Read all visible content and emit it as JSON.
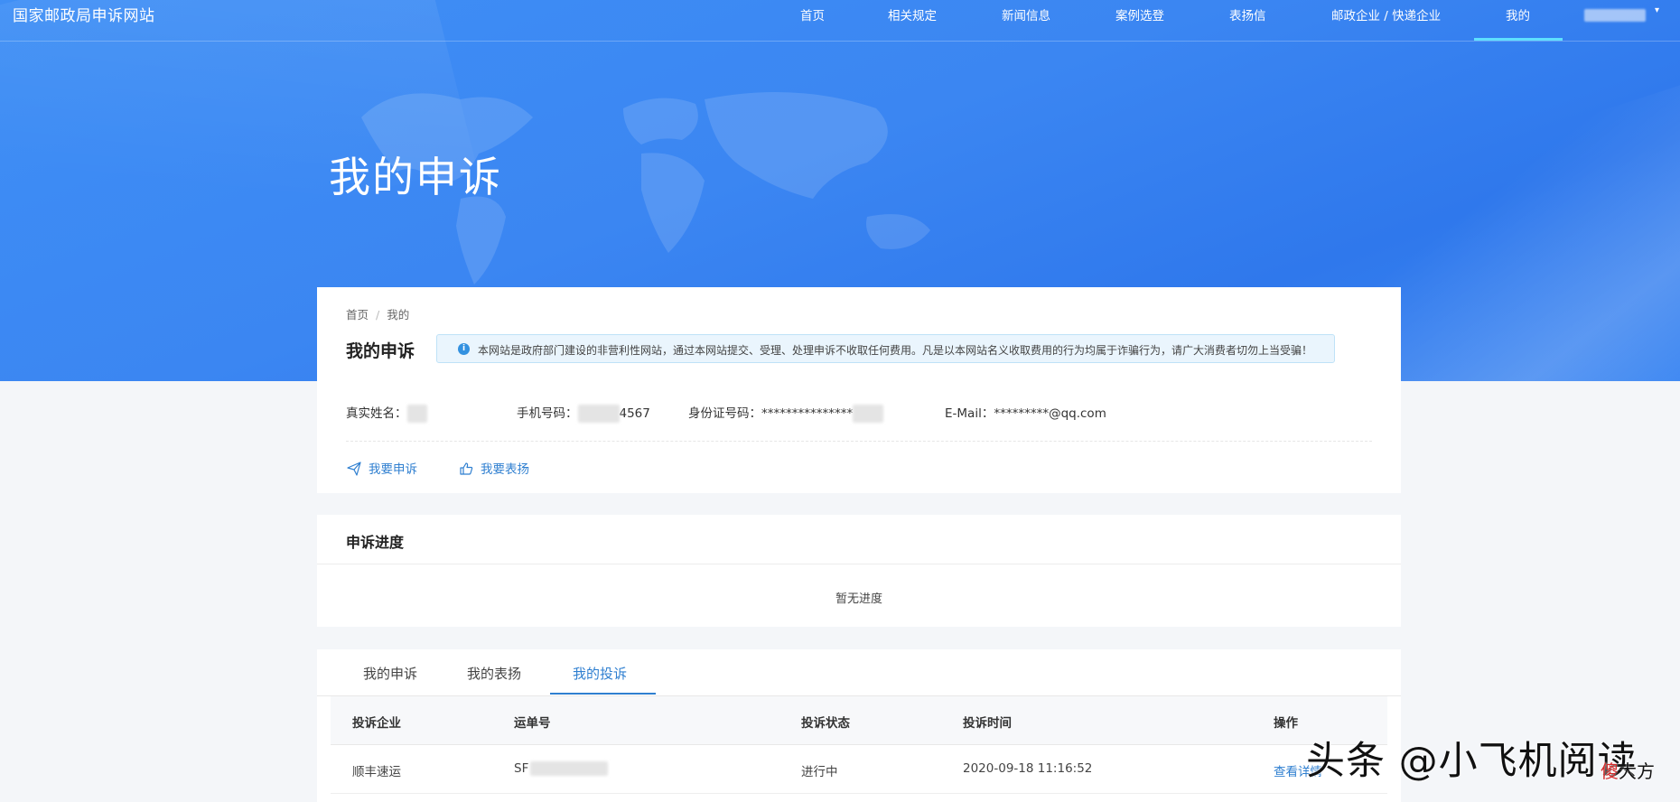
{
  "site": {
    "title": "国家邮政局申诉网站",
    "nav": [
      "首页",
      "相关规定",
      "新闻信息",
      "案例选登",
      "表扬信",
      "邮政企业 / 快递企业",
      "我的"
    ],
    "active_nav": "我的"
  },
  "hero": {
    "title": "我的申诉"
  },
  "breadcrumb": {
    "home": "首页",
    "sep": "/",
    "current": "我的"
  },
  "profile": {
    "title": "我的申诉",
    "notice": "本网站是政府部门建设的非营利性网站，通过本网站提交、受理、处理申诉不收取任何费用。凡是以本网站名义收取费用的行为均属于诈骗行为，请广大消费者切勿上当受骗！",
    "name_label": "真实姓名：",
    "phone_label": "手机号码：",
    "phone_suffix": "4567",
    "id_label": "身份证号码：",
    "id_value": "***************",
    "email_label": "E-Mail：",
    "email_value": "*********@qq.com",
    "actions": {
      "appeal": "我要申诉",
      "praise": "我要表扬"
    }
  },
  "progress": {
    "title": "申诉进度",
    "empty": "暂无进度"
  },
  "tabs": {
    "items": [
      "我的申诉",
      "我的表扬",
      "我的投诉"
    ],
    "active": "我的投诉"
  },
  "table": {
    "columns": [
      "投诉企业",
      "运单号",
      "投诉状态",
      "投诉时间",
      "操作"
    ],
    "rows": [
      {
        "company": "顺丰速运",
        "waybill": "SF",
        "status": "进行中",
        "time": "2020-09-18 11:16:52",
        "action": "查看详情"
      }
    ]
  },
  "watermark": {
    "main": "头条 @小飞机阅读",
    "small_red": "傻",
    "small": "大方"
  },
  "colors": {
    "hero": "#3b86f2",
    "link": "#2f7fd0",
    "nav_active": "#5ee0ff",
    "notice_bg": "#eaf5fd"
  }
}
